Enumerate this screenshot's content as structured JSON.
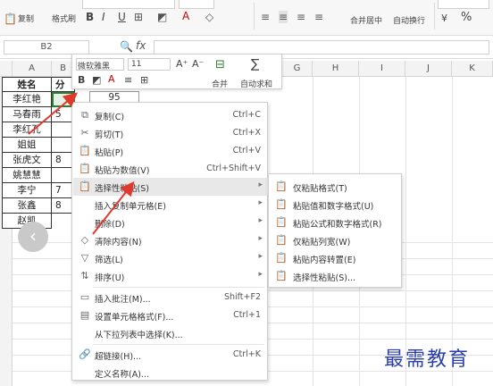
{
  "ribbon": {
    "copy_label": "复制",
    "format_painter_label": "格式刷",
    "merge_center_label": "合并居中",
    "auto_wrap_label": "自动换行",
    "percent_label": "%",
    "currency_label": "¥"
  },
  "formula_bar": {
    "namebox": "B2",
    "fx": "fx"
  },
  "columns": [
    "A",
    "B",
    "G",
    "H",
    "I",
    "J",
    "K"
  ],
  "rows": [
    {
      "name": "姓名",
      "b": "分"
    },
    {
      "name": "李红艳",
      "b": ""
    },
    {
      "name": "马春雨",
      "b": "5"
    },
    {
      "name": "李红孔",
      "b": ""
    },
    {
      "name": "姐姐",
      "b": ""
    },
    {
      "name": "张虎文",
      "b": "8"
    },
    {
      "name": "姚慧慧",
      "b": ""
    },
    {
      "name": "李宁",
      "b": "7"
    },
    {
      "name": "张鑫",
      "b": "8"
    },
    {
      "name": "赵凯",
      "b": ""
    }
  ],
  "cell_value_95": "95",
  "mini_toolbar": {
    "font": "微软雅黑",
    "size": "11",
    "merge": "合并",
    "autosum": "自动求和"
  },
  "context_menu": [
    {
      "label": "复制(C)",
      "shortcut": "Ctrl+C",
      "icon": "copy-icon"
    },
    {
      "label": "剪切(T)",
      "shortcut": "Ctrl+X",
      "icon": "cut-icon"
    },
    {
      "label": "粘贴(P)",
      "shortcut": "Ctrl+V",
      "icon": "paste-icon"
    },
    {
      "label": "粘贴为数值(V)",
      "shortcut": "Ctrl+Shift+V",
      "icon": "paste-values-icon"
    },
    {
      "label": "选择性粘贴(S)",
      "shortcut": "",
      "icon": "paste-special-icon",
      "submenu": true
    },
    {
      "label": "插入复制单元格(E)",
      "shortcut": "",
      "icon": "",
      "submenu": true
    },
    {
      "label": "删除(D)",
      "shortcut": "",
      "icon": "",
      "submenu": true
    },
    {
      "label": "清除内容(N)",
      "shortcut": "",
      "icon": "eraser-icon",
      "submenu": true
    },
    {
      "label": "筛选(L)",
      "shortcut": "",
      "icon": "filter-icon",
      "submenu": true
    },
    {
      "label": "排序(U)",
      "shortcut": "",
      "icon": "sort-icon",
      "submenu": true
    },
    {
      "label": "插入批注(M)...",
      "shortcut": "Shift+F2",
      "icon": "comment-icon"
    },
    {
      "label": "设置单元格格式(F)...",
      "shortcut": "Ctrl+1",
      "icon": "format-cells-icon"
    },
    {
      "label": "从下拉列表中选择(K)...",
      "shortcut": "",
      "icon": ""
    },
    {
      "label": "超链接(H)...",
      "shortcut": "Ctrl+K",
      "icon": "link-icon"
    },
    {
      "label": "定义名称(A)...",
      "shortcut": "",
      "icon": ""
    }
  ],
  "submenu": [
    {
      "label": "仅粘贴格式(T)",
      "icon": "paste-format-icon"
    },
    {
      "label": "粘贴值和数字格式(U)",
      "icon": "paste-value-number-icon"
    },
    {
      "label": "粘贴公式和数字格式(R)",
      "icon": "paste-formula-number-icon"
    },
    {
      "label": "仅粘贴列宽(W)",
      "icon": "paste-column-width-icon"
    },
    {
      "label": "粘贴内容转置(E)",
      "icon": "paste-transpose-icon"
    },
    {
      "label": "选择性粘贴(S)...",
      "icon": "paste-special-icon"
    }
  ],
  "watermark": "最需教育",
  "accent_color": "#2b3fa8",
  "arrow_color": "#e03a2f"
}
